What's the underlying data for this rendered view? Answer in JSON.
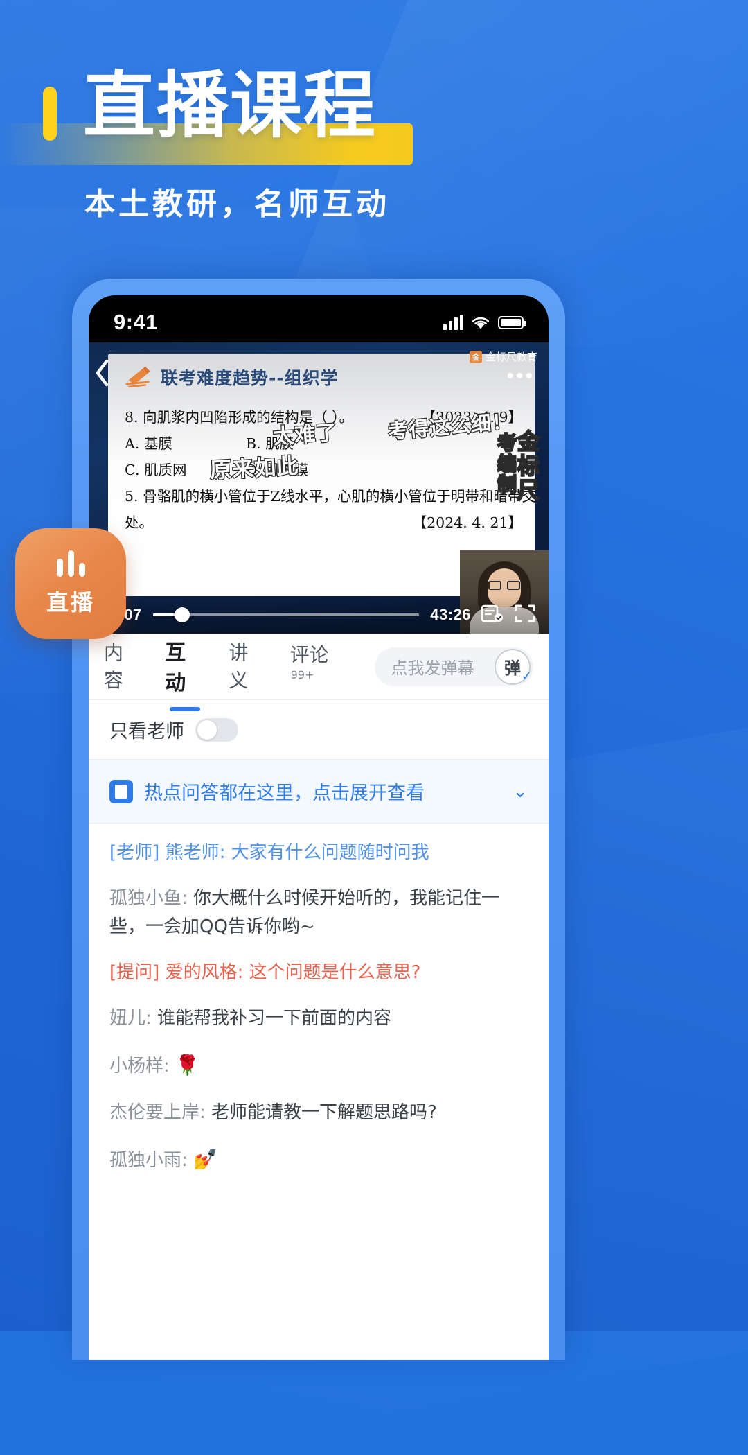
{
  "hero": {
    "title": "直播课程",
    "subtitle": "本土教研，名师互动"
  },
  "live_badge": {
    "label": "直播",
    "icon": "live-wave-icon"
  },
  "phone": {
    "status_bar": {
      "time": "9:41",
      "signal_icon": "cellular-signal-icon",
      "wifi_icon": "wifi-icon",
      "battery_icon": "battery-icon"
    },
    "video": {
      "back_icon": "back-chevron-icon",
      "brand": "金标尺教育",
      "brand_mark": "金",
      "more_icon": "more-dots-icon",
      "slide": {
        "title": "联考难度趋势--组织学",
        "pen_icon": "pencil-underline-icon",
        "q8": "8. 向肌浆内凹陷形成的结构是（  ）。",
        "q8_date": "【2023. 4. 9】",
        "options": [
          "A. 基膜",
          "B. 肌膜",
          "C. 肌质网",
          "D. 肌内膜"
        ],
        "q5_line1": "5. 骨骼肌的横小管位于Z线水平，心肌的横小管位于明带和暗带交界",
        "q5_line2": "处。",
        "q5_date": "【2024. 4. 21】"
      },
      "barrage": [
        "太难了",
        "原来如此",
        "考得这么细！",
        "考编制",
        "金标尺"
      ],
      "controls": {
        "current_time": "00:07",
        "total_time": "43:26",
        "progress_percent": 11,
        "note_icon": "note-capture-icon",
        "fullscreen_icon": "fullscreen-icon"
      },
      "teacher_pip": "teacher-camera-thumbnail"
    },
    "tabs": [
      {
        "label": "内容",
        "active": false,
        "badge": ""
      },
      {
        "label": "互动",
        "active": true,
        "badge": ""
      },
      {
        "label": "讲义",
        "active": false,
        "badge": ""
      },
      {
        "label": "评论",
        "active": false,
        "badge": "99+"
      }
    ],
    "danmu": {
      "placeholder": "点我发弹幕",
      "button_label": "弹",
      "check_icon": "check-icon"
    },
    "only_teacher": {
      "label": "只看老师",
      "enabled": false
    },
    "hot_banner": {
      "icon": "hot-qa-icon",
      "text": "热点问答都在这里，点击展开查看",
      "chevron_icon": "chevron-down-icon"
    },
    "chat": [
      {
        "prefix": "[老师] ",
        "name": "熊老师: ",
        "text": "大家有什么问题随时问我",
        "type": "teacher"
      },
      {
        "prefix": "",
        "name": "孤独小鱼: ",
        "text": "你大概什么时候开始听的，我能记住一些，一会加QQ告诉你哟~",
        "type": "normal"
      },
      {
        "prefix": "[提问] ",
        "name": "爱的风格: ",
        "text": "这个问题是什么意思?",
        "type": "ask"
      },
      {
        "prefix": "",
        "name": "妞儿: ",
        "text": "谁能帮我补习一下前面的内容",
        "type": "normal"
      },
      {
        "prefix": "",
        "name": "小杨样: ",
        "text": "🌹",
        "type": "normal"
      },
      {
        "prefix": "",
        "name": "杰伦要上岸: ",
        "text": "老师能请教一下解题思路吗?",
        "type": "normal"
      },
      {
        "prefix": "",
        "name": "孤独小雨: ",
        "text": "💅",
        "type": "normal"
      }
    ]
  },
  "colors": {
    "background_blue": "#2470dd",
    "accent_yellow": "#f5c91e",
    "accent_orange": "#e8874a",
    "link_blue": "#2f7ce8",
    "ask_red": "#e8614d"
  }
}
